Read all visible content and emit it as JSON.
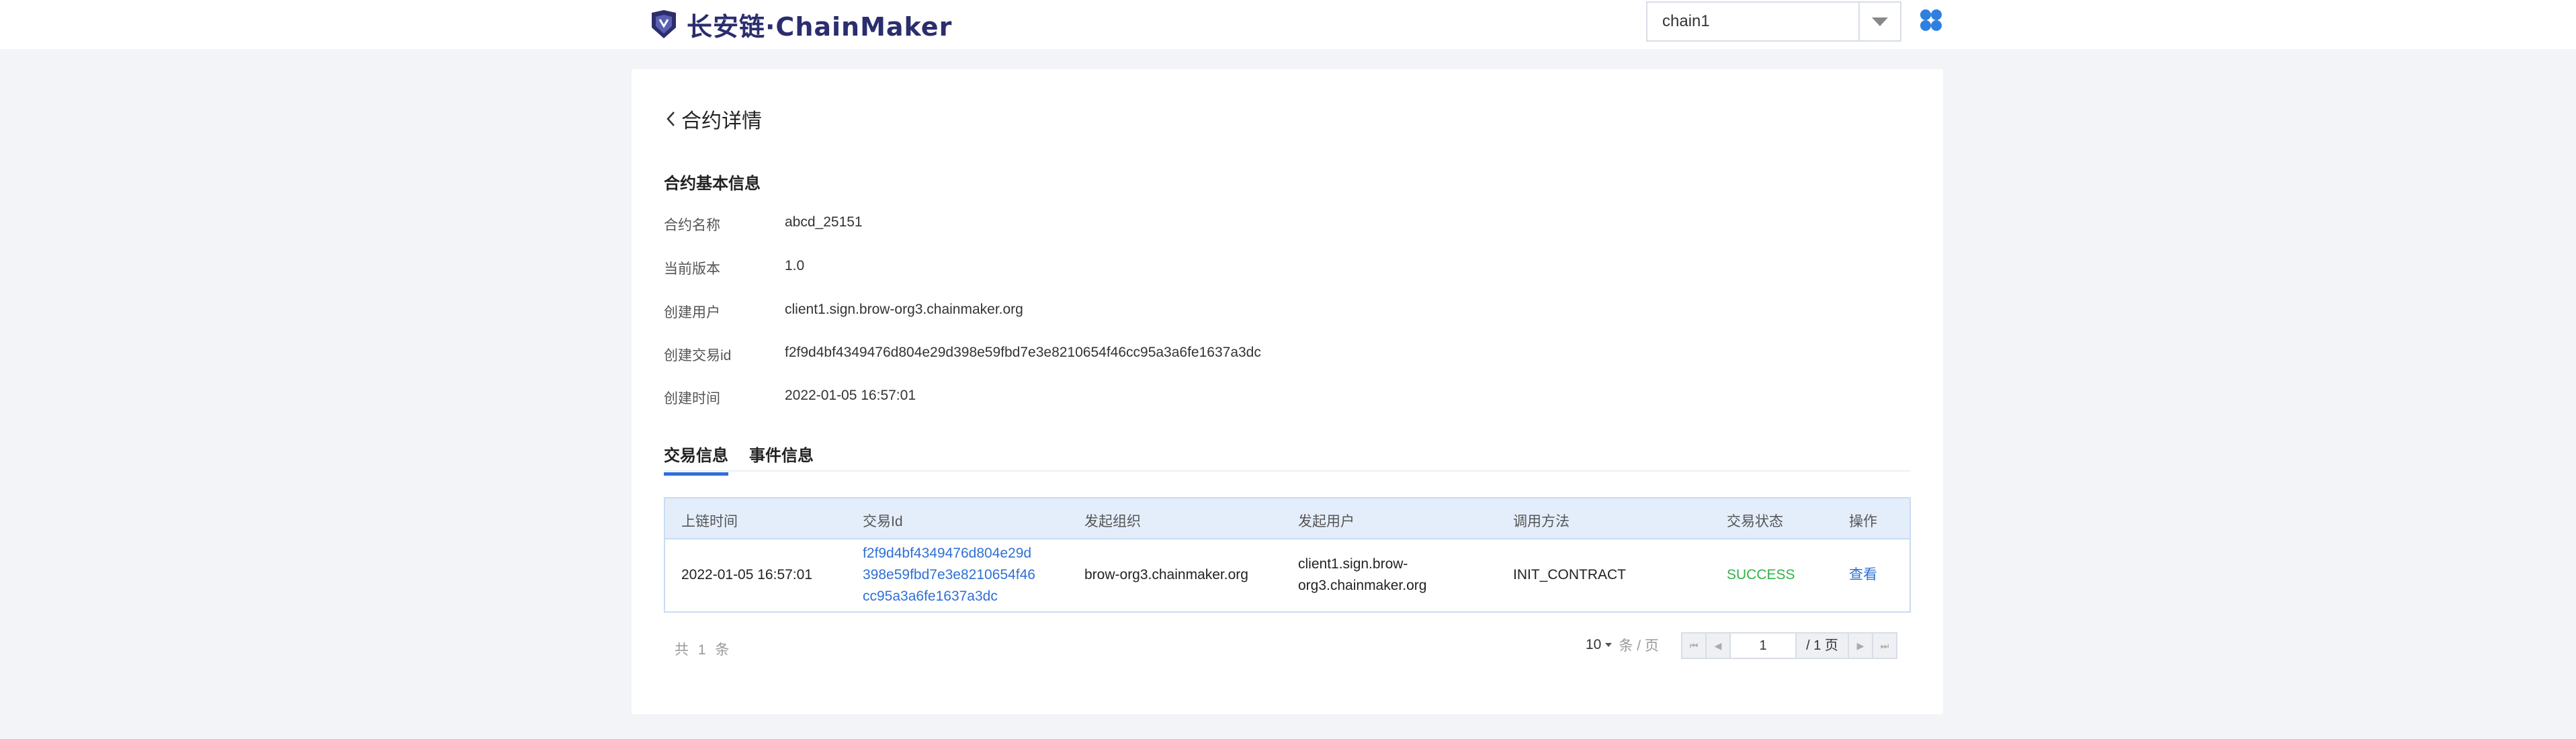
{
  "header": {
    "logo_text": "长安链·ChainMaker",
    "chain_select": {
      "value": "chain1"
    }
  },
  "page": {
    "title": "合约详情",
    "section_title": "合约基本信息",
    "info": [
      {
        "label": "合约名称",
        "value": "abcd_25151"
      },
      {
        "label": "当前版本",
        "value": "1.0"
      },
      {
        "label": "创建用户",
        "value": "client1.sign.brow-org3.chainmaker.org"
      },
      {
        "label": "创建交易id",
        "value": "f2f9d4bf4349476d804e29d398e59fbd7e3e8210654f46cc95a3a6fe1637a3dc"
      },
      {
        "label": "创建时间",
        "value": "2022-01-05 16:57:01"
      }
    ],
    "tabs": [
      {
        "label": "交易信息",
        "active": true
      },
      {
        "label": "事件信息",
        "active": false
      }
    ]
  },
  "table": {
    "columns": [
      "上链时间",
      "交易Id",
      "发起组织",
      "发起用户",
      "调用方法",
      "交易状态",
      "操作"
    ],
    "rows": [
      {
        "time": "2022-01-05 16:57:01",
        "tx_id_lines": [
          "f2f9d4bf4349476d804e29d",
          "398e59fbd7e3e8210654f46",
          "cc95a3a6fe1637a3dc"
        ],
        "org": "brow-org3.chainmaker.org",
        "user_lines": [
          "client1.sign.brow-",
          "org3.chainmaker.org"
        ],
        "method": "INIT_CONTRACT",
        "status": "SUCCESS",
        "action": "查看"
      }
    ]
  },
  "pagination": {
    "total_text": "共 1 条",
    "page_size": "10",
    "page_size_unit": "条 / 页",
    "current_page": "1",
    "total_pages": "/ 1 页"
  },
  "colors": {
    "accent": "#2f6fd6",
    "success": "#31b24a",
    "brand": "#2b2d6e"
  }
}
